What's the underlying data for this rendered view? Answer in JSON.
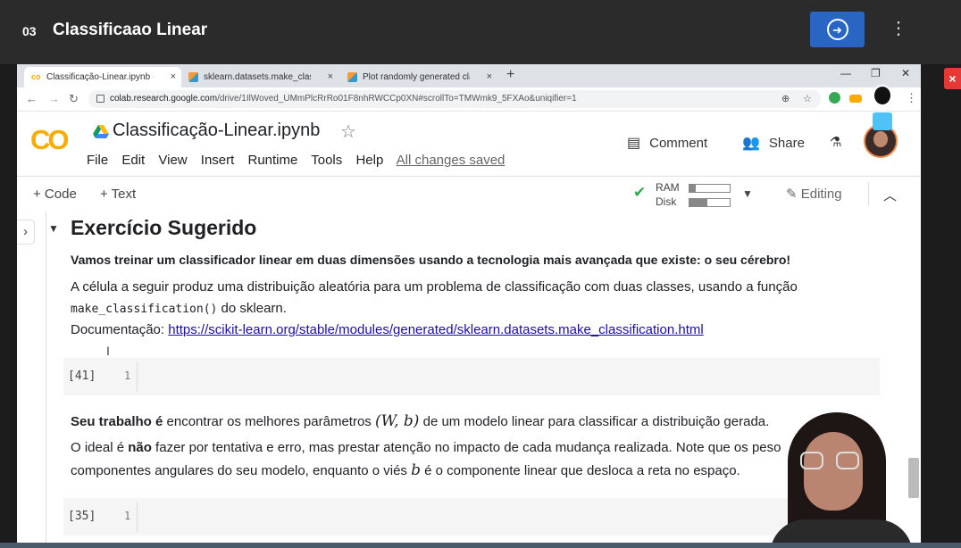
{
  "player": {
    "lesson_number": "03",
    "lesson_title": "Classificaao Linear",
    "next_icon": "arrow-right-circle-icon",
    "more_icon": "kebab-vertical-icon",
    "close_label": "×"
  },
  "browser": {
    "tabs": [
      {
        "label": "Classificação-Linear.ipynb - Cola",
        "icon": "colab-icon"
      },
      {
        "label": "sklearn.datasets.make_classificati",
        "icon": "sklearn-icon"
      },
      {
        "label": "Plot randomly generated classific",
        "icon": "sklearn-icon"
      }
    ],
    "tab_close": "×",
    "new_tab": "+",
    "url_host": "colab.research.google.com",
    "url_path": "/drive/1IlWoved_UMmPlcRrRo01F8nhRWCCp0XN#scrollTo=TMWmk9_5FXAo&uniqifier=1"
  },
  "colab": {
    "logo": "CO",
    "notebook_title": "Classificação-Linear.ipynb",
    "menu": [
      "File",
      "Edit",
      "View",
      "Insert",
      "Runtime",
      "Tools",
      "Help"
    ],
    "save_status": "All changes saved",
    "comment_label": "Comment",
    "share_label": "Share",
    "add_code": "+ Code",
    "add_text": "+ Text",
    "ram_label": "RAM",
    "disk_label": "Disk",
    "ram_level": 0.15,
    "disk_level": 0.45,
    "editing_label": "Editing"
  },
  "notebook": {
    "section_title": "Exercício Sugerido",
    "intro_bold": "Vamos treinar um classificador linear em duas dimensões usando a tecnologia mais avançada que existe: o seu cérebro!",
    "para1_a": "A célula a seguir produz uma distribuição aleatória para um problema de classificação com duas classes, usando a função",
    "para1_code": "make_classification()",
    "para1_b": " do sklearn.",
    "doc_label": "Documentação: ",
    "doc_link": "https://scikit-learn.org/stable/modules/generated/sklearn.datasets.make_classification.html",
    "cell1_num": "[41]",
    "cell1_line": "1",
    "task_bold": "Seu trabalho é",
    "task_text_a": " encontrar os melhores parâmetros ",
    "task_math": "(W, b)",
    "task_text_b": " de um modelo linear para classificar a distribuição gerada.",
    "ideal_a": "O ideal é ",
    "ideal_bold": "não",
    "ideal_b": " fazer por tentativa e erro, mas prestar atenção no impacto de cada mudança realizada. Note que os peso",
    "ideal_line2_a": "componentes angulares do seu modelo, enquanto o viés ",
    "ideal_math": "b",
    "ideal_line2_b": " é o componente linear que desloca a reta no espaço.",
    "cell2_num": "[35]",
    "cell2_line": "1"
  }
}
